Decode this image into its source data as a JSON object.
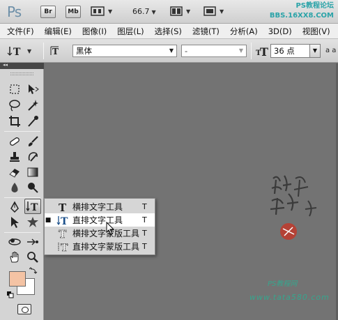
{
  "app": {
    "logo": "Ps",
    "buttons": [
      "Br",
      "Mb"
    ],
    "zoom": "66.7",
    "watermark_line1": "PS教程论坛",
    "watermark_line2": "BBS.16XX8.COM"
  },
  "menu": [
    "文件(F)",
    "编辑(E)",
    "图像(I)",
    "图层(L)",
    "选择(S)",
    "滤镜(T)",
    "分析(A)",
    "3D(D)",
    "视图(V)"
  ],
  "options": {
    "font_family": "黑体",
    "font_style": "-",
    "font_size": "36 点",
    "aa_label": "a a"
  },
  "flyout": {
    "items": [
      {
        "label": "横排文字工具",
        "shortcut": "T",
        "selected": false
      },
      {
        "label": "直排文字工具",
        "shortcut": "T",
        "selected": true
      },
      {
        "label": "横排文字蒙版工具",
        "shortcut": "T",
        "selected": false
      },
      {
        "label": "直排文字蒙版工具",
        "shortcut": "T",
        "selected": false
      }
    ]
  },
  "colors": {
    "foreground": "#f4c3a4",
    "background": "#ffffff"
  },
  "canvas_watermark": {
    "line1": "PS教程网",
    "line2": "www.tata580.com"
  }
}
